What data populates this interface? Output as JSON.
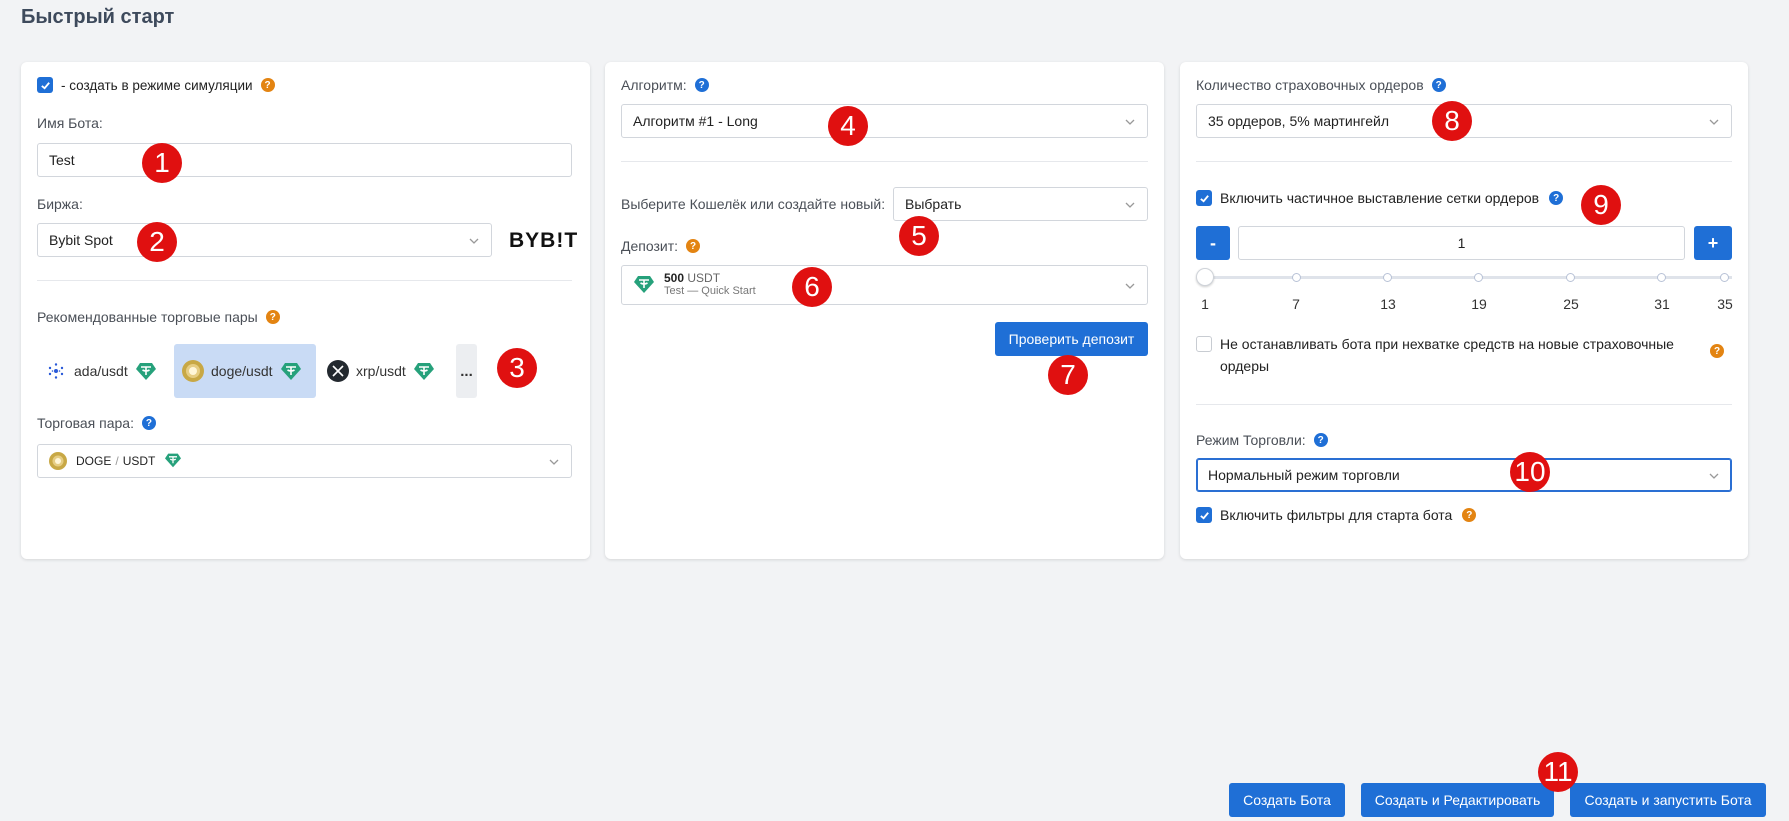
{
  "page_title": "Быстрый старт",
  "card1": {
    "simulation_label": "- создать в режиме симуляции",
    "bot_name_label": "Имя Бота:",
    "bot_name_value": "Test",
    "exchange_label": "Биржа:",
    "exchange_value": "Bybit Spot",
    "exchange_logo": "BYB!T",
    "recommended_label": "Рекомендованные торговые пары",
    "pairs": [
      {
        "name": "ada/usdt",
        "icon": "cardano-icon"
      },
      {
        "name": "doge/usdt",
        "icon": "dogecoin-icon"
      },
      {
        "name": "xrp/usdt",
        "icon": "xrp-icon"
      }
    ],
    "more_label": "...",
    "trading_pair_label": "Торговая пара:",
    "trading_pair_base": "DOGE",
    "trading_pair_sep": "/",
    "trading_pair_quote": "USDT"
  },
  "card2": {
    "algorithm_label": "Алгоритм:",
    "algorithm_value": "Алгоритм #1 - Long",
    "wallet_label": "Выберите Кошелёк или создайте новый:",
    "wallet_value": "Выбрать",
    "deposit_label": "Депозит:",
    "deposit_amount": "500",
    "deposit_currency": "USDT",
    "deposit_sub": "Test — Quick Start",
    "check_deposit_button": "Проверить депозит"
  },
  "card3": {
    "safety_orders_label": "Количество страховочных ордеров",
    "safety_orders_value": "35 ордеров, 5% мартингейл",
    "partial_grid_label": "Включить частичное выставление сетки ордеров",
    "stepper_minus": "-",
    "stepper_plus": "+",
    "stepper_value": "1",
    "slider_ticks": [
      "1",
      "7",
      "13",
      "19",
      "25",
      "31",
      "35"
    ],
    "slider_value": 1,
    "no_stop_label_1": "Не останавливать бота при нехватке средств на новые страховочные",
    "no_stop_label_2": "ордеры",
    "trade_mode_label": "Режим Торговли:",
    "trade_mode_value": "Нормальный режим торговли",
    "filters_label": "Включить фильтры для старта бота"
  },
  "footer": {
    "create_bot": "Создать Бота",
    "create_edit": "Создать и Редактировать",
    "create_run": "Создать и запустить Бота"
  },
  "markers": [
    "1",
    "2",
    "3",
    "4",
    "5",
    "6",
    "7",
    "8",
    "9",
    "10",
    "11"
  ],
  "help_glyph": "?",
  "colors": {
    "accent": "#1f6fd6",
    "help_orange": "#e38412",
    "marker_red": "#e01010",
    "tether_green": "#26a17b"
  }
}
